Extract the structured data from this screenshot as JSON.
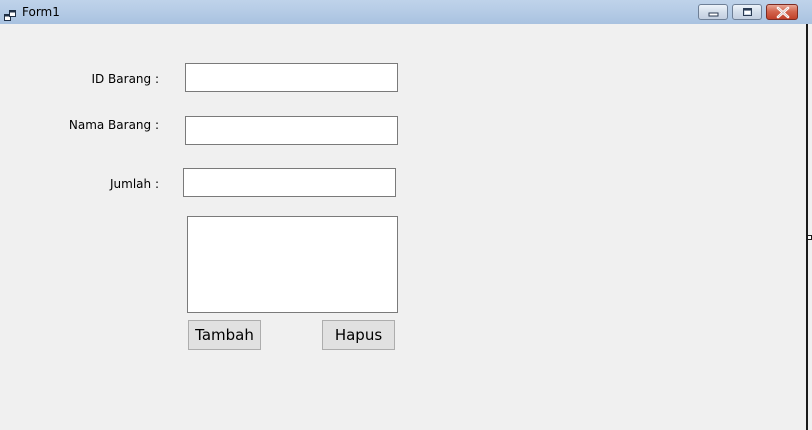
{
  "window": {
    "title": "Form1",
    "icons": {
      "app": "form-app-icon",
      "minimize": "minimize-icon",
      "maximize": "maximize-icon",
      "close": "close-icon"
    },
    "colors": {
      "titlebar": "#b6cce6",
      "client_background": "#f0f0f0",
      "close_button": "#c1412a"
    }
  },
  "form": {
    "id_barang": {
      "label": "ID Barang :",
      "value": ""
    },
    "nama_barang": {
      "label": "Nama Barang :",
      "value": ""
    },
    "jumlah": {
      "label": "Jumlah :",
      "value": ""
    },
    "list_box": {
      "value": ""
    },
    "tambah_label": "Tambah",
    "hapus_label": "Hapus"
  }
}
